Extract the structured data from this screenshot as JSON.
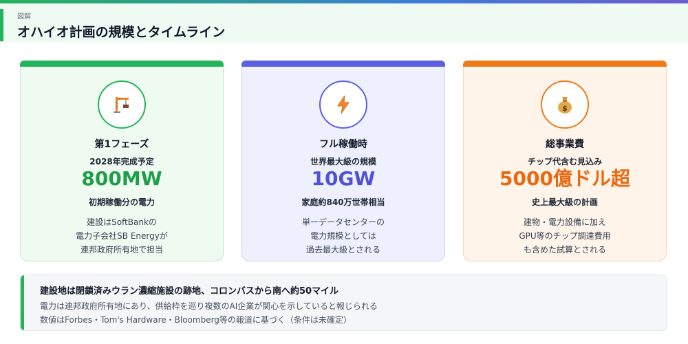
{
  "header": {
    "label": "図解",
    "title": "オハイオ計画の規模とタイムライン"
  },
  "cards": [
    {
      "icon": "crane-icon",
      "heading": "第1フェーズ",
      "sub": "2028年完成予定",
      "big": "800MW",
      "note": "初期稼働分の電力",
      "desc": [
        "建設はSoftBankの",
        "電力子会社SB Energyが",
        "連邦政府所有地で担当"
      ],
      "accent": "#22b45a"
    },
    {
      "icon": "lightning-icon",
      "heading": "フル稼働時",
      "sub": "世界最大級の規模",
      "big": "10GW",
      "note": "家庭約840万世帯相当",
      "desc": [
        "単一データセンターの",
        "電力規模としては",
        "過去最大級とされる"
      ],
      "accent": "#5b5fe0"
    },
    {
      "icon": "money-bag-icon",
      "heading": "総事業費",
      "sub": "チップ代含む見込み",
      "big": "5000億ドル超",
      "note": "史上最大級の計画",
      "desc": [
        "建物・電力設備に加え",
        "GPU等のチップ調達費用",
        "も含めた試算とされる"
      ],
      "accent": "#f07a1a"
    }
  ],
  "info": {
    "line1": "建設地は閉鎖済みウラン濃縮施設の跡地、コロンバスから南へ約50マイル",
    "line2": "電力は連邦政府所有地にあり、供給枠を巡り複数のAI企業が関心を示していると報じられる",
    "line3": "数値はForbes・Tom's Hardware・Bloomberg等の報道に基づく（条件は未確定）"
  }
}
